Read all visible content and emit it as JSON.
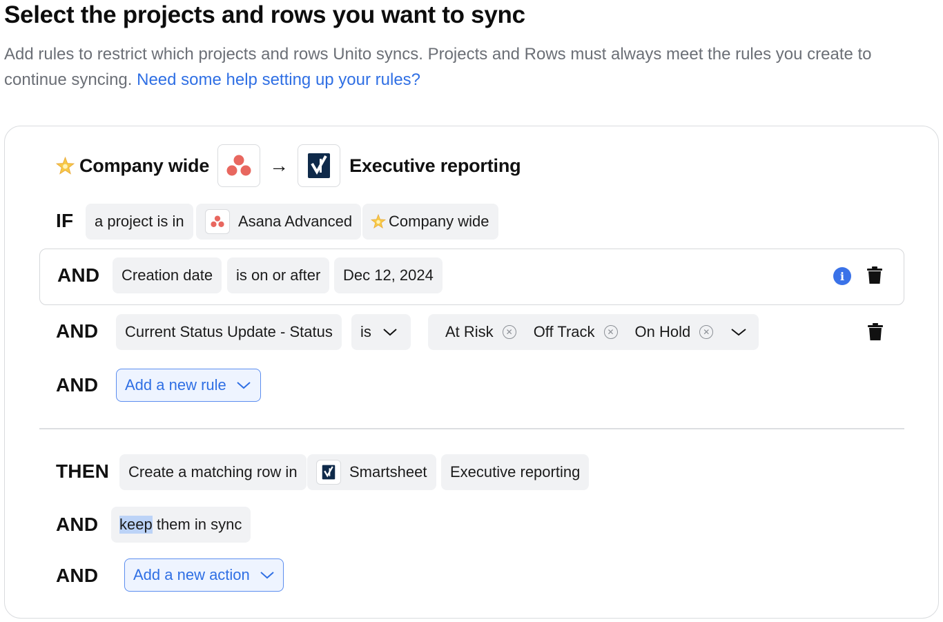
{
  "page": {
    "title": "Select the projects and rows you want to sync",
    "subtitle": "Add rules to restrict which projects and rows Unito syncs. Projects and Rows must always meet the rules you create to continue syncing.",
    "help_link": "Need some help setting up your rules?"
  },
  "flow": {
    "source_name": "Company wide",
    "arrow": "→",
    "target_name": "Executive reporting"
  },
  "if_rule": {
    "keyword": "IF",
    "condition": "a project is in",
    "workspace": "Asana Advanced",
    "project": "Company wide"
  },
  "rules": [
    {
      "keyword": "AND",
      "field": "Creation date",
      "operator": "is on or after",
      "value": "Dec 12, 2024"
    },
    {
      "keyword": "AND",
      "field": "Current Status Update - Status",
      "operator": "is",
      "values": [
        "At Risk",
        "Off Track",
        "On Hold"
      ]
    }
  ],
  "add_rule": {
    "keyword": "AND",
    "label": "Add a new rule"
  },
  "then_rule": {
    "keyword": "THEN",
    "action": "Create a matching row in",
    "tool": "Smartsheet",
    "sheet": "Executive reporting"
  },
  "sync_rule": {
    "keyword": "AND",
    "highlighted": "keep",
    "rest": " them in sync"
  },
  "add_action": {
    "keyword": "AND",
    "label": "Add a new action"
  },
  "colors": {
    "link": "#2f6fe4",
    "asana": "#e8675f",
    "smartsheet": "#0f2a4a",
    "info": "#3a72e8",
    "chip_bg": "#f1f2f4"
  }
}
